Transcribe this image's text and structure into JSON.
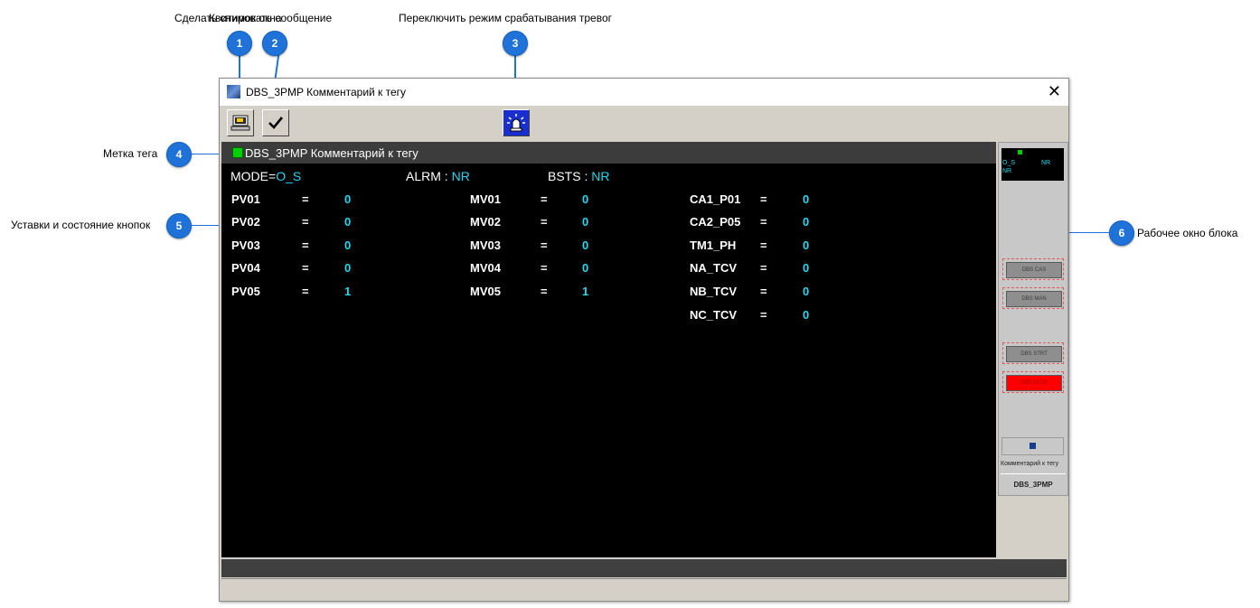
{
  "callouts": [
    {
      "num": "1",
      "label": "Сделать снимок окна"
    },
    {
      "num": "2",
      "label": "Квитировать сообщение"
    },
    {
      "num": "3",
      "label": "Переключить режим срабатывания тревог"
    },
    {
      "num": "4",
      "label": "Метка тега"
    },
    {
      "num": "5",
      "label": "Уставки и состояние кнопок"
    },
    {
      "num": "6",
      "label": "Рабочее окно блока"
    }
  ],
  "window": {
    "title": "DBS_3PMP Комментарий к тегу",
    "close": "✕"
  },
  "tag_label": "DBS_3PMP Комментарий к тегу",
  "status": {
    "mode_label": "MODE=",
    "mode_value": "O_S",
    "alrm_label": "ALRM :",
    "alrm_value": "NR",
    "bsts_label": "BSTS :",
    "bsts_value": "NR"
  },
  "params": {
    "col1": [
      {
        "name": "PV01",
        "eq": "=",
        "value": "0"
      },
      {
        "name": "PV02",
        "eq": "=",
        "value": "0"
      },
      {
        "name": "PV03",
        "eq": "=",
        "value": "0"
      },
      {
        "name": "PV04",
        "eq": "=",
        "value": "0"
      },
      {
        "name": "PV05",
        "eq": "=",
        "value": "1"
      }
    ],
    "col2": [
      {
        "name": "MV01",
        "eq": "=",
        "value": "0"
      },
      {
        "name": "MV02",
        "eq": "=",
        "value": "0"
      },
      {
        "name": "MV03",
        "eq": "=",
        "value": "0"
      },
      {
        "name": "MV04",
        "eq": "=",
        "value": "0"
      },
      {
        "name": "MV05",
        "eq": "=",
        "value": "1"
      }
    ],
    "col3": [
      {
        "name": "CA1_P01",
        "eq": "=",
        "value": "0"
      },
      {
        "name": "CA2_P05",
        "eq": "=",
        "value": "0"
      },
      {
        "name": "TM1_PH",
        "eq": "=",
        "value": "0"
      },
      {
        "name": "NA_TCV",
        "eq": "=",
        "value": "0"
      },
      {
        "name": "NB_TCV",
        "eq": "=",
        "value": "0"
      },
      {
        "name": "NC_TCV",
        "eq": "=",
        "value": "0"
      }
    ]
  },
  "faceplate": {
    "mode": "O_S",
    "alrm": "NR",
    "bsts": "NR",
    "buttons": [
      "DBS CAS",
      "DBS MAN",
      "DBS STRT",
      "DBS STOP"
    ],
    "comment": "Комментарий к тегу",
    "tag": "DBS_3PMP"
  },
  "colors": {
    "badge": "#1f73d8",
    "value_cyan": "#22d8f0",
    "tag_indicator": "#00d000",
    "stop_button": "#ff0000"
  },
  "icons": [
    "window-snapshot-icon",
    "checkmark-icon",
    "alarm-siren-icon"
  ]
}
